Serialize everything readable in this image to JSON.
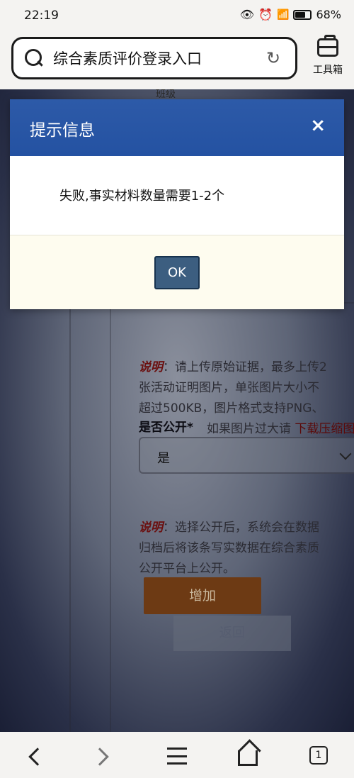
{
  "status_bar": {
    "time": "22:19",
    "battery": "68%"
  },
  "browser": {
    "search_text": "综合素质评价登录入口",
    "toolbox_label": "工具箱"
  },
  "page": {
    "class_label": "班级",
    "note1": {
      "lead": "说明",
      "lines": [
        "：请上传原始证据，最多上传2",
        "张活动证明图片，单张图片大小不",
        "超过500KB，图片格式支持PNG、"
      ],
      "last_line": "如果图片过大请 ",
      "link": "下载压缩图"
    },
    "public_label": "是否公开*",
    "public_select_value": "是",
    "note2": {
      "lead": "说明",
      "lines": [
        "：选择公开后，系统会在数据",
        "归档后将该条写实数据在综合素质",
        "公开平台上公开。"
      ]
    },
    "add_button": "增加",
    "back_button": "返回"
  },
  "modal": {
    "title": "提示信息",
    "close": "×",
    "message": "失败,事实材料数量需要1-2个",
    "ok_button": "OK"
  },
  "bottom_nav": {
    "tab_count": "1"
  }
}
